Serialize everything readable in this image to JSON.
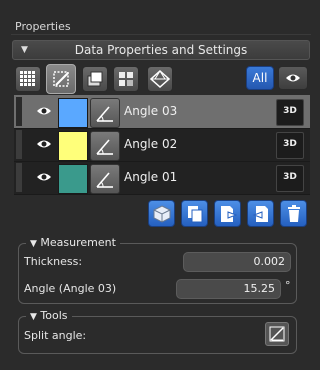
{
  "panel": {
    "title": "Properties"
  },
  "section": {
    "title": "Data Properties and Settings"
  },
  "toolbar": {
    "all_label": "All"
  },
  "layers": [
    {
      "label": "Angle 03",
      "color": "#5aa8ff",
      "selected": true,
      "badge": "3D"
    },
    {
      "label": "Angle 02",
      "color": "#ffff7a",
      "selected": false,
      "badge": "3D"
    },
    {
      "label": "Angle 01",
      "color": "#3a9a8c",
      "selected": false,
      "badge": "3D"
    }
  ],
  "measurement": {
    "title": "Measurement",
    "thickness_label": "Thickness:",
    "thickness_value": "0.002",
    "angle_label": "Angle (Angle 03)",
    "angle_value": "15.25",
    "angle_unit": "°"
  },
  "tools": {
    "title": "Tools",
    "split_label": "Split angle:"
  }
}
